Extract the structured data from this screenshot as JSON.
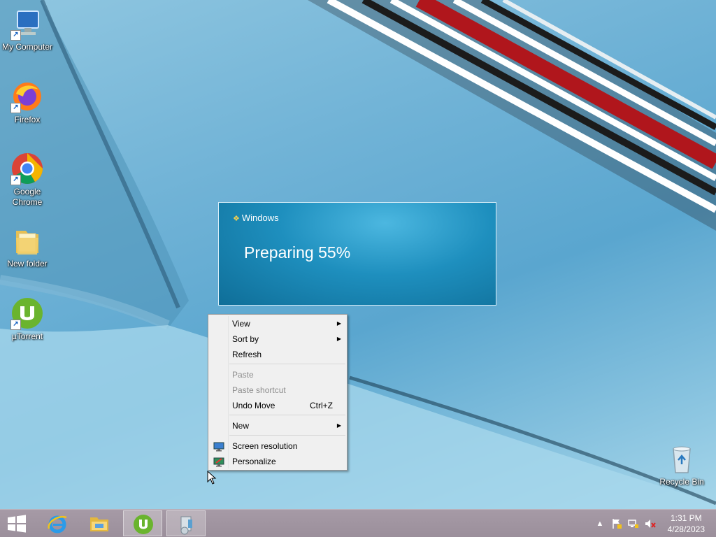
{
  "desktop": {
    "icons": [
      {
        "label": "My Computer",
        "icon": "computer-icon"
      },
      {
        "label": "Firefox",
        "icon": "firefox-icon"
      },
      {
        "label": "Google\nChrome",
        "icon": "chrome-icon"
      },
      {
        "label": "New folder",
        "icon": "folder-icon"
      },
      {
        "label": "µTorrent",
        "icon": "utorrent-icon"
      },
      {
        "label": "Recycle Bin",
        "icon": "recycle-bin-icon"
      }
    ]
  },
  "progress_window": {
    "brand": "Windows",
    "message": "Preparing 55%",
    "percent": 55
  },
  "context_menu": {
    "items": {
      "view": "View",
      "sort_by": "Sort by",
      "refresh": "Refresh",
      "paste": "Paste",
      "paste_shortcut": "Paste shortcut",
      "undo_move": "Undo Move",
      "undo_move_shortcut": "Ctrl+Z",
      "new": "New",
      "screen_resolution": "Screen resolution",
      "personalize": "Personalize"
    }
  },
  "taskbar": {
    "clock_time": "1:31 PM",
    "clock_date": "4/28/2023",
    "buttons": [
      "start-icon",
      "internet-explorer-icon",
      "file-explorer-icon",
      "utorrent-icon",
      "installer-icon"
    ]
  },
  "colors": {
    "taskbar": "#9b8f9b",
    "progress_bg": "#1e8fbe",
    "menu_bg": "#f0f0f0"
  }
}
